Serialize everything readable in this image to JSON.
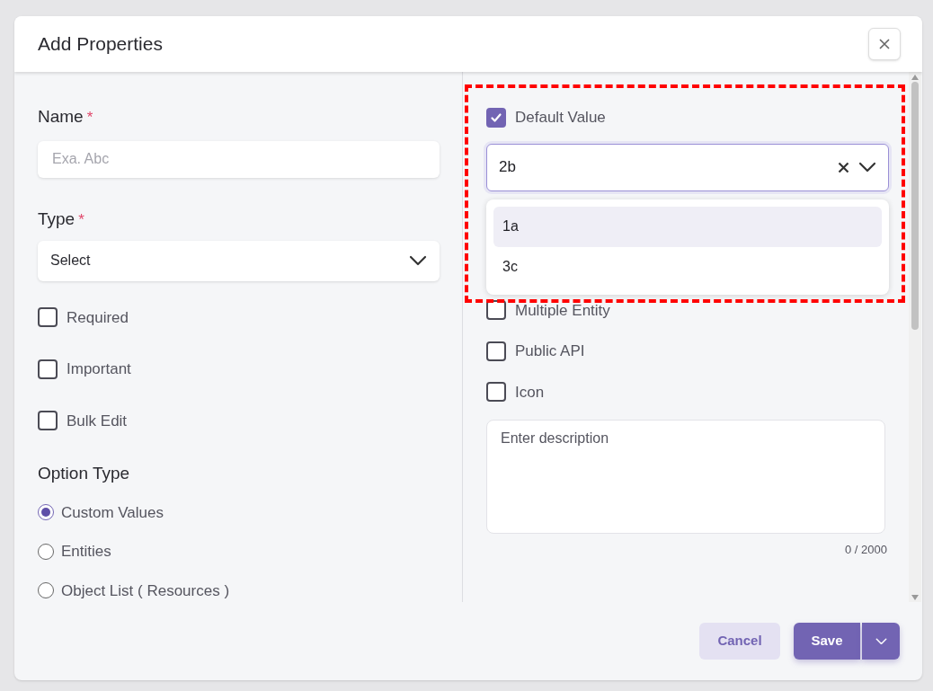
{
  "dialog": {
    "title": "Add Properties"
  },
  "left": {
    "name_field": {
      "label": "Name",
      "required_mark": "*",
      "placeholder": "Exa. Abc"
    },
    "type_field": {
      "label": "Type",
      "required_mark": "*",
      "value": "Select"
    },
    "checkboxes": [
      {
        "label": "Required",
        "checked": false
      },
      {
        "label": "Important",
        "checked": false
      },
      {
        "label": "Bulk Edit",
        "checked": false
      }
    ],
    "option_type": {
      "label": "Option Type",
      "options": [
        {
          "label": "Custom Values",
          "selected": true
        },
        {
          "label": "Entities",
          "selected": false
        },
        {
          "label": "Object List ( Resources )",
          "selected": false
        }
      ]
    }
  },
  "right": {
    "default_value": {
      "label": "Default Value",
      "checked": true
    },
    "default_select": {
      "value": "2b",
      "expanded": true,
      "options": [
        {
          "label": "1a",
          "highlighted": true
        },
        {
          "label": "3c",
          "highlighted": false
        }
      ]
    },
    "checkboxes": [
      {
        "label": "Multiple Entity",
        "checked": false
      },
      {
        "label": "Public API",
        "checked": false
      },
      {
        "label": "Icon",
        "checked": false
      }
    ],
    "description": {
      "placeholder": "Enter description",
      "counter": "0 / 2000"
    }
  },
  "footer": {
    "buttons": [
      {
        "label": "Cancel",
        "kind": "secondary"
      },
      {
        "label": "Save",
        "kind": "primary"
      }
    ]
  }
}
